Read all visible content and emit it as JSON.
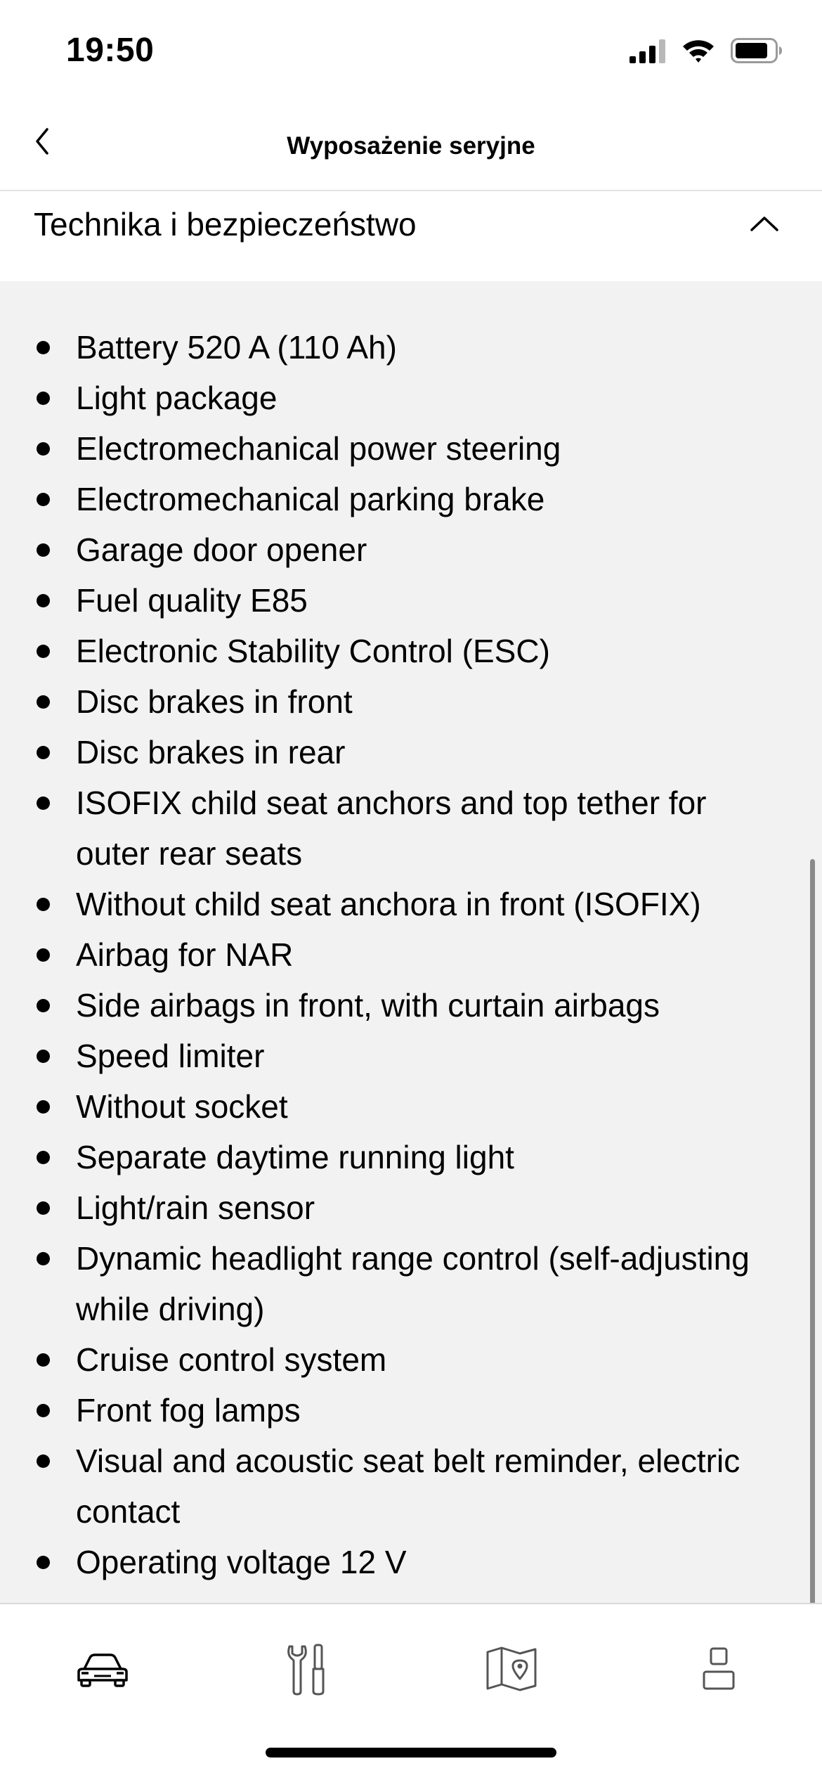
{
  "status_bar": {
    "time": "19:50",
    "icons": [
      "cellular-signal-icon",
      "wifi-icon",
      "battery-icon"
    ]
  },
  "header": {
    "title": "Wyposażenie seryjne",
    "back_icon": "chevron-left-icon"
  },
  "section": {
    "title": "Technika i bezpieczeństwo",
    "collapse_icon": "chevron-up-icon"
  },
  "features": [
    "Battery 520 A (110 Ah)",
    "Light package",
    "Electromechanical power steering",
    "Electromechanical parking brake",
    "Garage door opener",
    "Fuel quality E85",
    "Electronic Stability Control (ESC)",
    "Disc brakes in front",
    "Disc brakes in rear",
    "ISOFIX child seat anchors and top tether for outer rear seats",
    "Without child seat anchora in front (ISOFIX)",
    "Airbag for NAR",
    "Side airbags in front, with curtain airbags",
    "Speed limiter",
    "Without socket",
    "Separate daytime running light",
    "Light/rain sensor",
    "Dynamic headlight range control (self-adjusting while driving)",
    "Cruise control system",
    "Front fog lamps",
    "Visual and acoustic seat belt reminder, electric contact",
    "Operating voltage 12 V"
  ],
  "tab_bar": {
    "tabs": [
      "car-icon",
      "tools-icon",
      "map-icon",
      "profile-icon"
    ]
  },
  "colors": {
    "content_background": "#f2f2f2",
    "text": "#000000",
    "divider": "#e4e4e4"
  }
}
